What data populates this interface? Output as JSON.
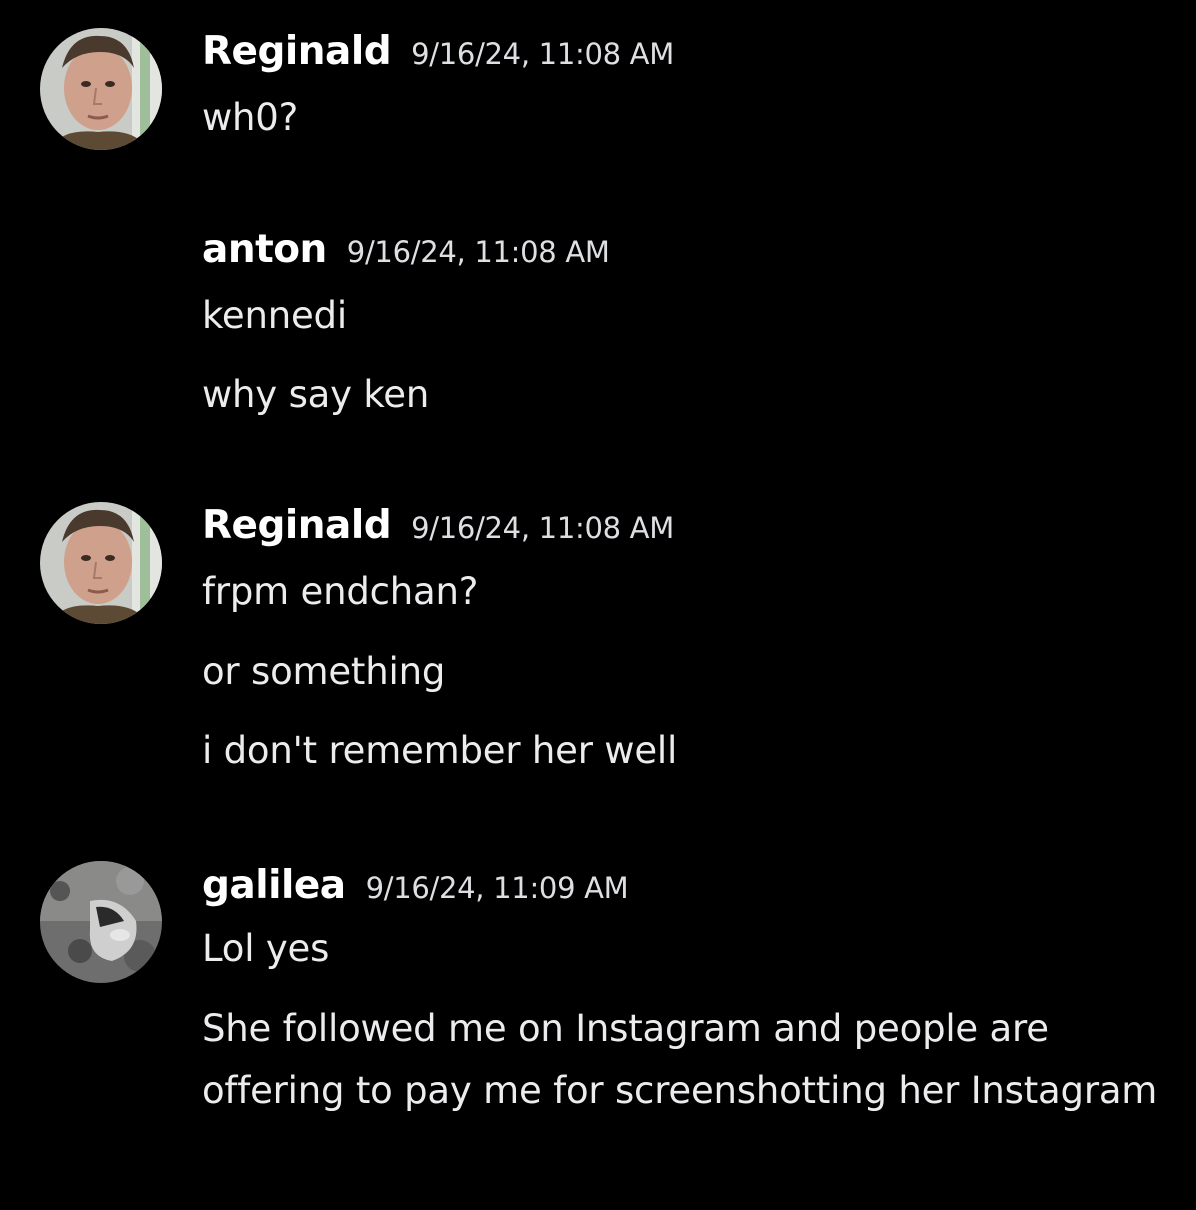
{
  "messages": [
    {
      "username": "Reginald",
      "timestamp": "9/16/24, 11:08 AM",
      "lines": [
        "wh0?"
      ]
    },
    {
      "username": "anton",
      "timestamp": "9/16/24, 11:08 AM",
      "lines": [
        "kennedi",
        "why say ken"
      ]
    },
    {
      "username": "Reginald",
      "timestamp": "9/16/24, 11:08 AM",
      "lines": [
        "frpm endchan?",
        "or something",
        "i don't remember her well"
      ]
    },
    {
      "username": "galilea",
      "timestamp": "9/16/24, 11:09 AM",
      "lines": [
        "Lol yes",
        "She followed me on Instagram and people are offering to pay me for screenshotting her Instagram"
      ]
    }
  ],
  "colors": {
    "background": "#000000",
    "username": "#ffffff",
    "timestamp": "#dedfe3",
    "message_text": "#ececee"
  }
}
